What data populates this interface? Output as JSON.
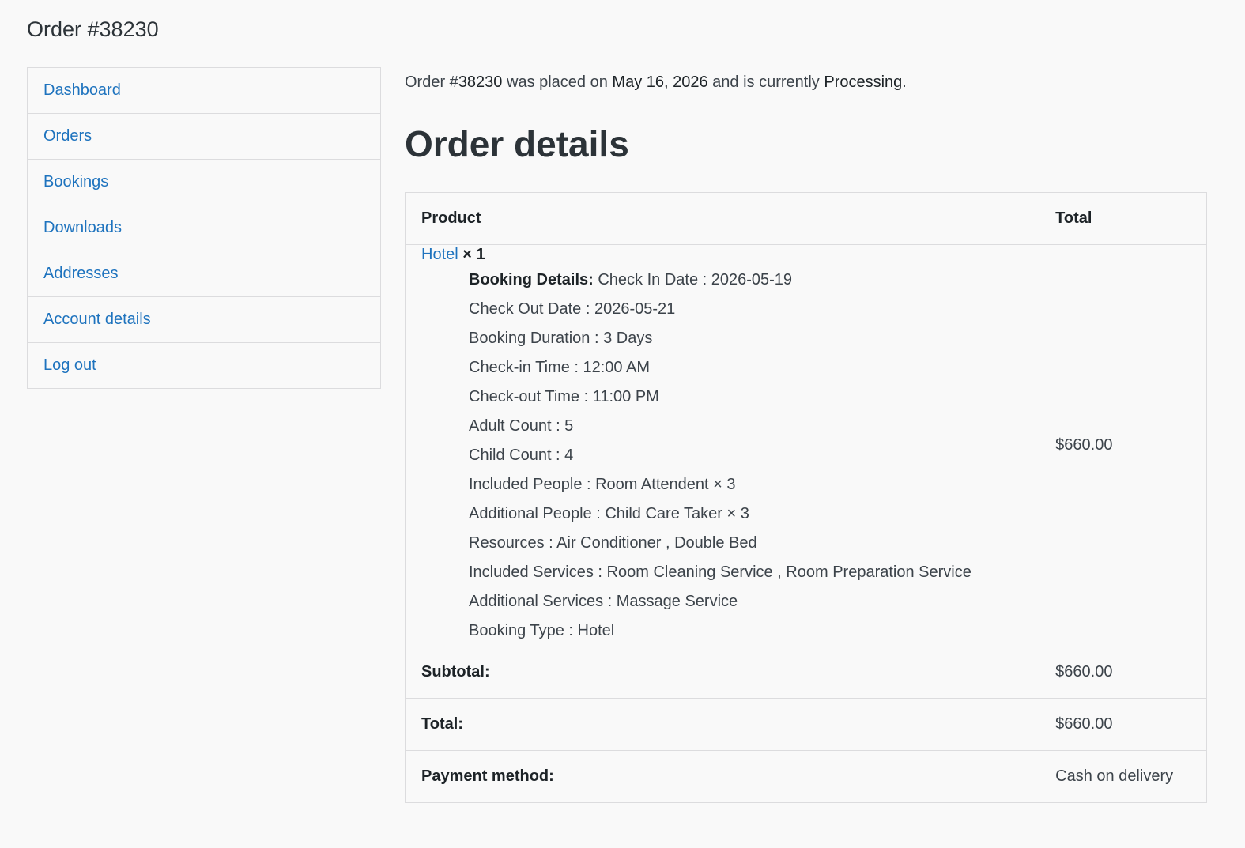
{
  "page": {
    "title": "Order #38230"
  },
  "nav": {
    "items": [
      {
        "label": "Dashboard"
      },
      {
        "label": "Orders"
      },
      {
        "label": "Bookings"
      },
      {
        "label": "Downloads"
      },
      {
        "label": "Addresses"
      },
      {
        "label": "Account details"
      },
      {
        "label": "Log out"
      }
    ]
  },
  "status": {
    "prefix": "Order #",
    "order_number": "38230",
    "placed_text": " was placed on ",
    "date": "May 16, 2026",
    "currently_text": " and is currently ",
    "state": "Processing",
    "suffix": "."
  },
  "details": {
    "title": "Order details",
    "headers": {
      "product": "Product",
      "total": "Total"
    },
    "item": {
      "name": "Hotel",
      "qty": " × 1",
      "total": "$660.00",
      "booking_label": "Booking Details:",
      "meta": [
        " Check In Date : 2026-05-19",
        "Check Out Date : 2026-05-21",
        "Booking Duration : 3 Days",
        "Check-in Time : 12:00 AM",
        "Check-out Time : 11:00 PM",
        "Adult Count : 5",
        "Child Count : 4",
        "Included People : Room Attendent × 3",
        "Additional People : Child Care Taker × 3",
        "Resources : Air Conditioner , Double Bed",
        "Included Services : Room Cleaning Service , Room Preparation Service",
        "Additional Services : Massage Service",
        "Booking Type : Hotel"
      ]
    },
    "footer": [
      {
        "label": "Subtotal:",
        "value": "$660.00"
      },
      {
        "label": "Total:",
        "value": "$660.00"
      },
      {
        "label": "Payment method:",
        "value": "Cash on delivery"
      }
    ]
  },
  "colors": {
    "link": "#1e73be",
    "border": "#dcdcde",
    "background": "#f9f9f9"
  }
}
